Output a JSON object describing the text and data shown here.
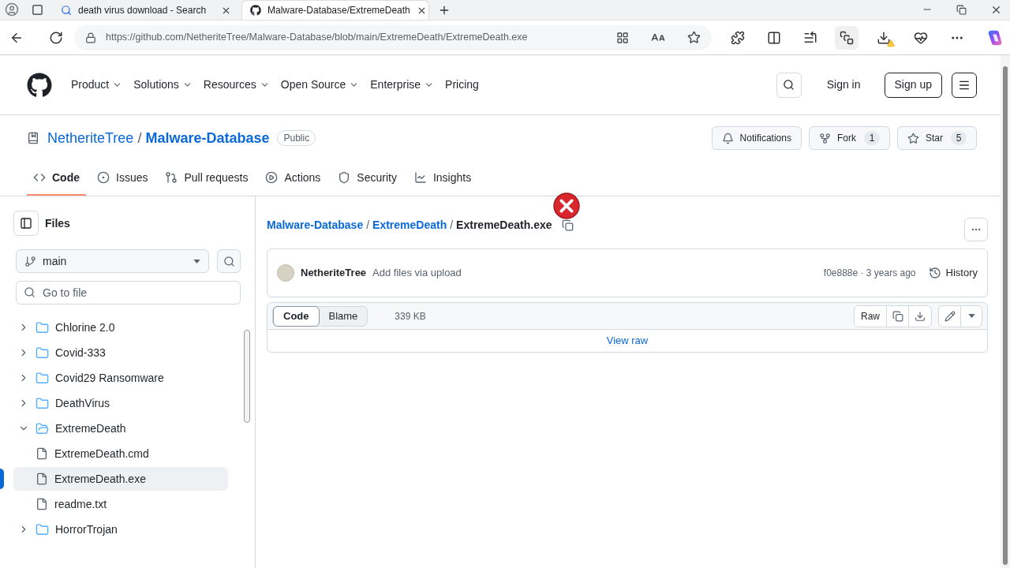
{
  "browser": {
    "tabs": [
      {
        "title": "death virus download - Search",
        "selected": false
      },
      {
        "title": "Malware-Database/ExtremeDeath",
        "selected": true
      }
    ],
    "url": "https://github.com/NetheriteTree/Malware-Database/blob/main/ExtremeDeath/ExtremeDeath.exe"
  },
  "header": {
    "nav": [
      {
        "label": "Product",
        "dropdown": true
      },
      {
        "label": "Solutions",
        "dropdown": true
      },
      {
        "label": "Resources",
        "dropdown": true
      },
      {
        "label": "Open Source",
        "dropdown": true
      },
      {
        "label": "Enterprise",
        "dropdown": true
      },
      {
        "label": "Pricing",
        "dropdown": false
      }
    ],
    "sign_in": "Sign in",
    "sign_up": "Sign up"
  },
  "repo": {
    "owner": "NetheriteTree",
    "separator": "/",
    "name": "Malware-Database",
    "visibility": "Public",
    "actions": [
      {
        "kind": "notifications",
        "label": "Notifications"
      },
      {
        "kind": "fork",
        "label": "Fork",
        "count": "1"
      },
      {
        "kind": "star",
        "label": "Star",
        "count": "5"
      }
    ]
  },
  "repo_tabs": [
    {
      "label": "Code",
      "selected": true
    },
    {
      "label": "Issues",
      "selected": false
    },
    {
      "label": "Pull requests",
      "selected": false
    },
    {
      "label": "Actions",
      "selected": false
    },
    {
      "label": "Security",
      "selected": false
    },
    {
      "label": "Insights",
      "selected": false
    }
  ],
  "files_panel": {
    "title": "Files",
    "branch": "main",
    "search": {
      "placeholder": "Go to file"
    },
    "tree": [
      {
        "kind": "folder",
        "name": "Chlorine 2.0",
        "expanded": false,
        "selected": false
      },
      {
        "kind": "folder",
        "name": "Covid-333",
        "expanded": false,
        "selected": false
      },
      {
        "kind": "folder",
        "name": "Covid29 Ransomware",
        "expanded": false,
        "selected": false
      },
      {
        "kind": "folder",
        "name": "DeathVirus",
        "expanded": false,
        "selected": false
      },
      {
        "kind": "folder",
        "name": "ExtremeDeath",
        "expanded": true,
        "selected": false,
        "children": [
          {
            "kind": "file",
            "name": "ExtremeDeath.cmd",
            "selected": false
          },
          {
            "kind": "file",
            "name": "ExtremeDeath.exe",
            "selected": true
          },
          {
            "kind": "file",
            "name": "readme.txt",
            "selected": false
          }
        ]
      },
      {
        "kind": "folder",
        "name": "HorrorTrojan",
        "expanded": false,
        "selected": false
      }
    ]
  },
  "file_view": {
    "breadcrumb": {
      "parts": [
        "Malware-Database",
        "ExtremeDeath",
        "ExtremeDeath.exe"
      ],
      "separator": "/"
    },
    "commit": {
      "author": "NetheriteTree",
      "message": "Add files via upload",
      "meta": "f0e888e · 3 years ago",
      "history": "History"
    },
    "view_tabs": [
      {
        "label": "Code",
        "selected": true
      },
      {
        "label": "Blame",
        "selected": false
      }
    ],
    "size": "339 KB",
    "raw": "Raw",
    "view_raw": "View raw"
  }
}
